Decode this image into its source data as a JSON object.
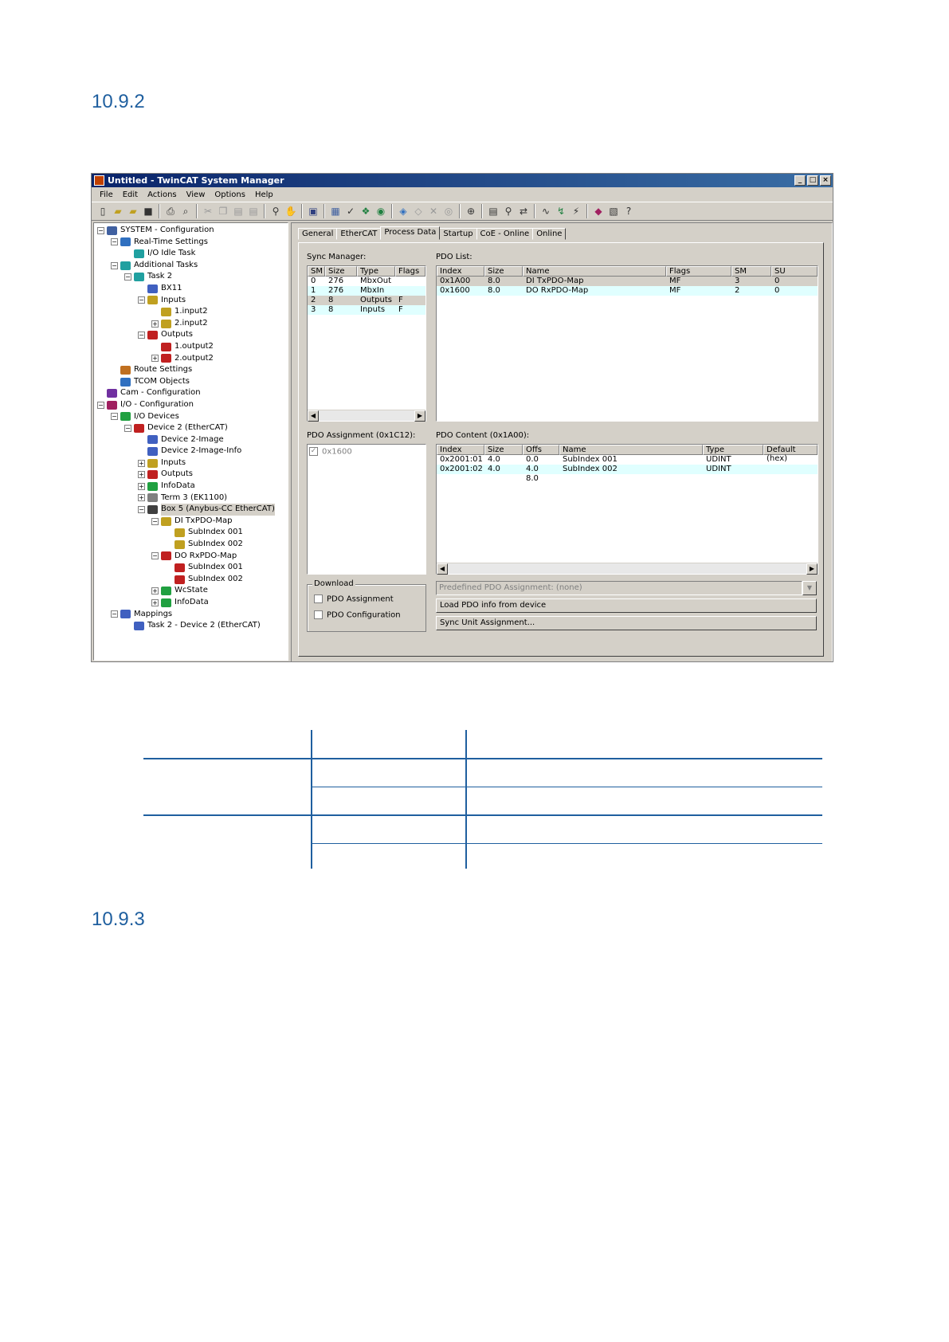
{
  "headings": {
    "section1": "10.9.2",
    "section2": "10.9.3"
  },
  "window": {
    "title": "Untitled - TwinCAT System Manager",
    "menu": [
      "File",
      "Edit",
      "Actions",
      "View",
      "Options",
      "Help"
    ]
  },
  "tree": [
    {
      "label": "SYSTEM - Configuration",
      "depth": 0,
      "expander": "-",
      "icon": "system-icon",
      "color": "#4060a0"
    },
    {
      "label": "Real-Time Settings",
      "depth": 1,
      "expander": "-",
      "icon": "realtime-icon",
      "color": "#3070c0"
    },
    {
      "label": "I/O Idle Task",
      "depth": 2,
      "expander": "",
      "icon": "task-icon",
      "color": "#20a0a0"
    },
    {
      "label": "Additional Tasks",
      "depth": 1,
      "expander": "-",
      "icon": "tasks-icon",
      "color": "#20a0a0"
    },
    {
      "label": "Task 2",
      "depth": 2,
      "expander": "-",
      "icon": "task-icon",
      "color": "#20a0a0"
    },
    {
      "label": "BX11",
      "depth": 3,
      "expander": "",
      "icon": "var-icon",
      "color": "#4060c0"
    },
    {
      "label": "Inputs",
      "depth": 3,
      "expander": "-",
      "icon": "inputs-icon",
      "color": "#c0a020"
    },
    {
      "label": "1.input2",
      "depth": 4,
      "expander": "",
      "icon": "input-var-icon",
      "color": "#c0a020"
    },
    {
      "label": "2.input2",
      "depth": 4,
      "expander": "+",
      "icon": "input-var-icon",
      "color": "#c0a020"
    },
    {
      "label": "Outputs",
      "depth": 3,
      "expander": "-",
      "icon": "outputs-icon",
      "color": "#c02020"
    },
    {
      "label": "1.output2",
      "depth": 4,
      "expander": "",
      "icon": "output-var-icon",
      "color": "#c02020"
    },
    {
      "label": "2.output2",
      "depth": 4,
      "expander": "+",
      "icon": "output-var-icon",
      "color": "#c02020"
    },
    {
      "label": "Route Settings",
      "depth": 1,
      "expander": "",
      "icon": "route-icon",
      "color": "#c07020"
    },
    {
      "label": "TCOM Objects",
      "depth": 1,
      "expander": "",
      "icon": "tcom-icon",
      "color": "#3070c0"
    },
    {
      "label": "Cam - Configuration",
      "depth": 0,
      "expander": "",
      "icon": "cam-icon",
      "color": "#7030a0"
    },
    {
      "label": "I/O - Configuration",
      "depth": 0,
      "expander": "-",
      "icon": "io-config-icon",
      "color": "#a02060"
    },
    {
      "label": "I/O Devices",
      "depth": 1,
      "expander": "-",
      "icon": "io-devices-icon",
      "color": "#20a040"
    },
    {
      "label": "Device 2 (EtherCAT)",
      "depth": 2,
      "expander": "-",
      "icon": "ethercat-device-icon",
      "color": "#c02020"
    },
    {
      "label": "Device 2-Image",
      "depth": 3,
      "expander": "",
      "icon": "image-icon",
      "color": "#4060c0"
    },
    {
      "label": "Device 2-Image-Info",
      "depth": 3,
      "expander": "",
      "icon": "image-icon",
      "color": "#4060c0"
    },
    {
      "label": "Inputs",
      "depth": 3,
      "expander": "+",
      "icon": "inputs-icon",
      "color": "#c0a020"
    },
    {
      "label": "Outputs",
      "depth": 3,
      "expander": "+",
      "icon": "outputs-icon",
      "color": "#c02020"
    },
    {
      "label": "InfoData",
      "depth": 3,
      "expander": "+",
      "icon": "infodata-icon",
      "color": "#20a040"
    },
    {
      "label": "Term 3 (EK1100)",
      "depth": 3,
      "expander": "+",
      "icon": "terminal-icon",
      "color": "#808080"
    },
    {
      "label": "Box 5 (Anybus-CC EtherCAT)",
      "depth": 3,
      "expander": "-",
      "icon": "box-icon",
      "color": "#404040",
      "selected": true
    },
    {
      "label": "DI TxPDO-Map",
      "depth": 4,
      "expander": "-",
      "icon": "txpdo-icon",
      "color": "#c0a020"
    },
    {
      "label": "SubIndex 001",
      "depth": 5,
      "expander": "",
      "icon": "input-var-icon",
      "color": "#c0a020"
    },
    {
      "label": "SubIndex 002",
      "depth": 5,
      "expander": "",
      "icon": "input-var-icon",
      "color": "#c0a020"
    },
    {
      "label": "DO RxPDO-Map",
      "depth": 4,
      "expander": "-",
      "icon": "rxpdo-icon",
      "color": "#c02020"
    },
    {
      "label": "SubIndex 001",
      "depth": 5,
      "expander": "",
      "icon": "output-var-icon",
      "color": "#c02020"
    },
    {
      "label": "SubIndex 002",
      "depth": 5,
      "expander": "",
      "icon": "output-var-icon",
      "color": "#c02020"
    },
    {
      "label": "WcState",
      "depth": 4,
      "expander": "+",
      "icon": "wcstate-icon",
      "color": "#20a040"
    },
    {
      "label": "InfoData",
      "depth": 4,
      "expander": "+",
      "icon": "infodata-icon",
      "color": "#20a040"
    },
    {
      "label": "Mappings",
      "depth": 1,
      "expander": "-",
      "icon": "mappings-icon",
      "color": "#4060c0"
    },
    {
      "label": "Task 2 - Device 2 (EtherCAT)",
      "depth": 2,
      "expander": "",
      "icon": "mapping-icon",
      "color": "#4060c0"
    }
  ],
  "tabs": [
    "General",
    "EtherCAT",
    "Process Data",
    "Startup",
    "CoE - Online",
    "Online"
  ],
  "active_tab": "Process Data",
  "sync_manager": {
    "label": "Sync Manager:",
    "columns": [
      "SM",
      "Size",
      "Type",
      "Flags"
    ],
    "rows": [
      {
        "cells": [
          "0",
          "276",
          "MbxOut",
          ""
        ],
        "style": ""
      },
      {
        "cells": [
          "1",
          "276",
          "MbxIn",
          ""
        ],
        "style": "cyan"
      },
      {
        "cells": [
          "2",
          "8",
          "Outputs",
          "F"
        ],
        "style": "grey"
      },
      {
        "cells": [
          "3",
          "8",
          "Inputs",
          "F"
        ],
        "style": "cyan"
      }
    ]
  },
  "pdo_list": {
    "label": "PDO List:",
    "columns": [
      "Index",
      "Size",
      "Name",
      "Flags",
      "SM",
      "SU"
    ],
    "rows": [
      {
        "cells": [
          "0x1A00",
          "8.0",
          "DI TxPDO-Map",
          "MF",
          "3",
          "0"
        ],
        "style": "grey"
      },
      {
        "cells": [
          "0x1600",
          "8.0",
          "DO RxPDO-Map",
          "MF",
          "2",
          "0"
        ],
        "style": "cyan"
      }
    ]
  },
  "pdo_assignment": {
    "label": "PDO Assignment (0x1C12):",
    "items": [
      {
        "label": "0x1600",
        "checked": "✓"
      }
    ]
  },
  "pdo_content": {
    "label": "PDO Content (0x1A00):",
    "columns": [
      "Index",
      "Size",
      "Offs",
      "Name",
      "Type",
      "Default (hex)"
    ],
    "rows": [
      {
        "cells": [
          "0x2001:01",
          "4.0",
          "0.0",
          "SubIndex 001",
          "UDINT",
          ""
        ],
        "style": ""
      },
      {
        "cells": [
          "0x2001:02",
          "4.0",
          "4.0",
          "SubIndex 002",
          "UDINT",
          ""
        ],
        "style": "cyan"
      },
      {
        "cells": [
          "",
          "",
          "8.0",
          "",
          "",
          ""
        ],
        "style": ""
      }
    ]
  },
  "download": {
    "label": "Download",
    "options": [
      "PDO Assignment",
      "PDO Configuration"
    ]
  },
  "predefined": "Predefined PDO Assignment: (none)",
  "buttons": {
    "load": "Load PDO info from device",
    "sync_unit": "Sync Unit Assignment..."
  },
  "colors": {
    "accent": "#1f5f9f",
    "titlebar": "#0a246a"
  }
}
